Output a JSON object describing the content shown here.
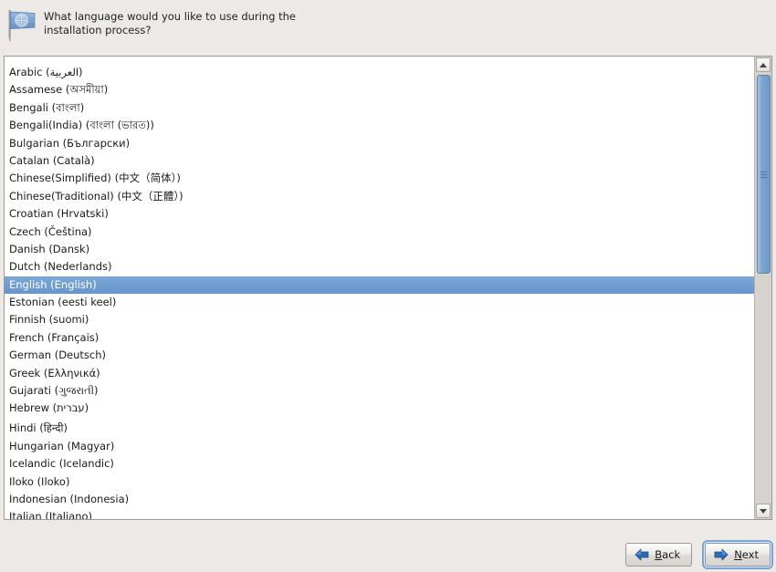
{
  "header": {
    "icon": "un-flag-icon",
    "prompt": "What language would you like to use during the\ninstallation process?"
  },
  "language_list": {
    "name": "language-list",
    "selected": "English (English)",
    "scroll_position": "top",
    "items": [
      {
        "label": "Arabic (العربية)",
        "tall": false
      },
      {
        "label": "Assamese (অসমীয়া)",
        "tall": false
      },
      {
        "label": "Bengali (বাংলা)",
        "tall": false
      },
      {
        "label": "Bengali(India) (বাংলা (ভারত))",
        "tall": false
      },
      {
        "label": "Bulgarian (Български)",
        "tall": false
      },
      {
        "label": "Catalan (Català)",
        "tall": false
      },
      {
        "label": "Chinese(Simplified) (中文（简体）)",
        "tall": false
      },
      {
        "label": "Chinese(Traditional) (中文（正體）)",
        "tall": false
      },
      {
        "label": "Croatian (Hrvatski)",
        "tall": false
      },
      {
        "label": "Czech (Čeština)",
        "tall": false
      },
      {
        "label": "Danish (Dansk)",
        "tall": false
      },
      {
        "label": "Dutch (Nederlands)",
        "tall": false
      },
      {
        "label": "English (English)",
        "tall": false
      },
      {
        "label": "Estonian (eesti keel)",
        "tall": false
      },
      {
        "label": "Finnish (suomi)",
        "tall": false
      },
      {
        "label": "French (Français)",
        "tall": false
      },
      {
        "label": "German (Deutsch)",
        "tall": false
      },
      {
        "label": "Greek (Ελληνικά)",
        "tall": false
      },
      {
        "label": "Gujarati (ગુજરાતી)",
        "tall": false
      },
      {
        "label": "Hebrew (עברית)",
        "tall": false
      },
      {
        "label": "Hindi (हिन्दी)",
        "tall": true
      },
      {
        "label": "Hungarian (Magyar)",
        "tall": false
      },
      {
        "label": "Icelandic (Icelandic)",
        "tall": false
      },
      {
        "label": "Iloko (Iloko)",
        "tall": false
      },
      {
        "label": "Indonesian (Indonesia)",
        "tall": false
      },
      {
        "label": "Italian (Italiano)",
        "tall": false
      }
    ]
  },
  "scrollbar": {
    "up_arrow": "scroll-up-icon",
    "down_arrow": "scroll-down-icon",
    "thumb": "scroll-thumb"
  },
  "buttons": {
    "back": {
      "label_prefix": "",
      "mnemonic": "B",
      "label_suffix": "ack",
      "icon": "arrow-left-icon",
      "focused": false
    },
    "next": {
      "label_prefix": "",
      "mnemonic": "N",
      "label_suffix": "ext",
      "icon": "arrow-right-icon",
      "focused": true
    }
  },
  "colors": {
    "background": "#ece9e7",
    "selection": "#6a9bd1",
    "list_background": "#ffffff",
    "accent_blue": "#2f6bb5"
  }
}
